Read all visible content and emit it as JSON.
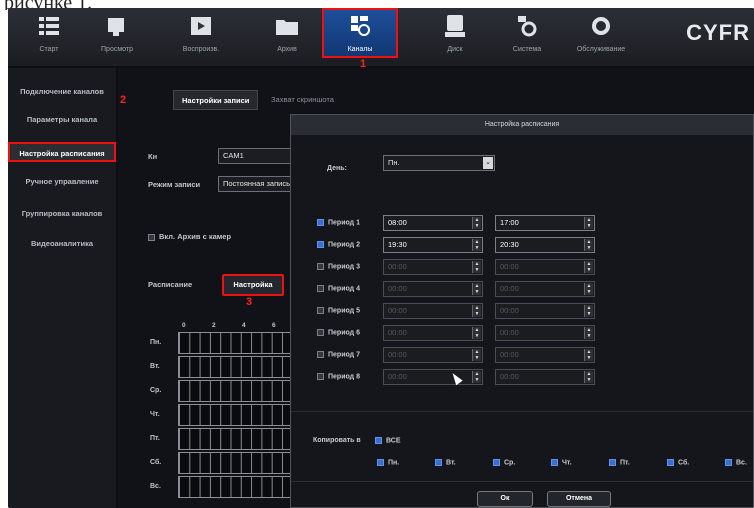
{
  "caption": "рисунке 1.",
  "brand": "CYFR",
  "nav": [
    {
      "label": "Старт",
      "icon": "grid-icon"
    },
    {
      "label": "Просмотр",
      "icon": "monitor-icon"
    },
    {
      "label": "Воспроизв.",
      "icon": "film-icon"
    },
    {
      "label": "Архив",
      "icon": "folder-icon"
    },
    {
      "label": "Каналы",
      "icon": "channels-icon"
    },
    {
      "label": "Диск",
      "icon": "disk-icon"
    },
    {
      "label": "Система",
      "icon": "system-gear-icon"
    },
    {
      "label": "Обслуживание",
      "icon": "gear-icon"
    }
  ],
  "annotations": {
    "n1": "1",
    "n2": "2",
    "n3": "3"
  },
  "sidebar": [
    {
      "label": "Подключение каналов"
    },
    {
      "label": "Параметры канала"
    },
    {
      "label": "Настройка расписания"
    },
    {
      "label": "Ручное управление"
    },
    {
      "label": "Группировка каналов"
    },
    {
      "label": "Видеоаналитика"
    }
  ],
  "tabs": [
    "Настройки записи",
    "Захват скриншота"
  ],
  "form": {
    "channel_label": "Кн",
    "channel_value": "CAM1",
    "mode_label": "Режим записи",
    "mode_value": "Постоянная запись",
    "archive_label": "Вкл. Архив с камер",
    "schedule_label": "Расписание",
    "setup_button": "Настройка"
  },
  "grid": {
    "hours": [
      "0",
      "2",
      "4",
      "6"
    ],
    "days": [
      "Пн.",
      "Вт.",
      "Ср.",
      "Чт.",
      "Пт.",
      "Сб.",
      "Вс."
    ]
  },
  "dialog": {
    "title": "Настройка расписания",
    "day_label": "День:",
    "day_value": "Пн.",
    "periods": [
      {
        "label": "Период 1",
        "start": "08:00",
        "end": "17:00",
        "enabled": true
      },
      {
        "label": "Период 2",
        "start": "19:30",
        "end": "20:30",
        "enabled": true
      },
      {
        "label": "Период 3",
        "start": "00:00",
        "end": "00:00",
        "enabled": false
      },
      {
        "label": "Период 4",
        "start": "00:00",
        "end": "00:00",
        "enabled": false
      },
      {
        "label": "Период 5",
        "start": "00:00",
        "end": "00:00",
        "enabled": false
      },
      {
        "label": "Период 6",
        "start": "00:00",
        "end": "00:00",
        "enabled": false
      },
      {
        "label": "Период 7",
        "start": "00:00",
        "end": "00:00",
        "enabled": false
      },
      {
        "label": "Период 8",
        "start": "00:00",
        "end": "00:00",
        "enabled": false
      }
    ],
    "copy_label": "Копировать в",
    "all_label": "ВСЕ",
    "copy_days": [
      "Пн.",
      "Вт.",
      "Ср.",
      "Чт.",
      "Пт.",
      "Сб.",
      "Вс."
    ],
    "ok": "Ок",
    "cancel": "Отмена"
  }
}
